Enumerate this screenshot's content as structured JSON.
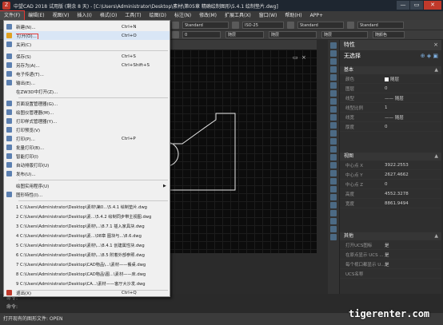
{
  "titlebar": {
    "title": "中望CAD 2018 试用版 (剩余 8 天) - [C:\\Users\\Administrator\\Desktop\\素材\\第05章 精确绘制图形\\5.4.1 绘制垫片.dwg]",
    "minimize": "—",
    "maximize": "▭",
    "close": "✕"
  },
  "menubar": [
    "文件(F)",
    "编辑(E)",
    "视图(V)",
    "插入(I)",
    "格式(O)",
    "工具(T)",
    "绘图(D)",
    "标注(N)",
    "修改(M)",
    "扩展工具(X)",
    "窗口(W)",
    "帮助(H)",
    "APP+"
  ],
  "toolbar": {
    "text_style": "Standard",
    "dim_style": "ISO-25",
    "table_style": "Standard",
    "multileader_style": "Standard",
    "layer_value": "0",
    "color_value": "随层",
    "linetype_value": "随层",
    "lineweight_value": "随层",
    "plotstyle_value": "随颜色"
  },
  "file_menu": {
    "items": [
      {
        "label": "新建(N)...",
        "shortcut": "Ctrl+N",
        "icon": "new-file-icon"
      },
      {
        "label": "打开(O)...",
        "shortcut": "Ctrl+O",
        "icon": "open-folder-icon",
        "highlighted": true
      },
      {
        "label": "关闭(C)",
        "shortcut": "",
        "icon": "close-file-icon"
      },
      {
        "label": "保存(S)",
        "shortcut": "Ctrl+S",
        "icon": "save-icon"
      },
      {
        "label": "另存为(A)...",
        "shortcut": "Ctrl+Shift+S",
        "icon": "save-as-icon"
      },
      {
        "label": "电子传递(T)...",
        "shortcut": "",
        "icon": "etransmit-icon"
      },
      {
        "label": "输出(E)...",
        "shortcut": "",
        "icon": "export-icon"
      },
      {
        "label": "在ZW3D中打开(Z)...",
        "shortcut": "",
        "icon": "zw3d-icon"
      },
      {
        "label": "页面设置管理器(G)...",
        "shortcut": "",
        "icon": "page-setup-icon"
      },
      {
        "label": "绘图仪管理器(M)...",
        "shortcut": "",
        "icon": "plotter-manager-icon"
      },
      {
        "label": "打印样式管理器(Y)...",
        "shortcut": "",
        "icon": "plot-style-icon"
      },
      {
        "label": "打印预览(V)",
        "shortcut": "",
        "icon": "print-preview-icon"
      },
      {
        "label": "打印(P)...",
        "shortcut": "Ctrl+P",
        "icon": "print-icon"
      },
      {
        "label": "批量打印(B)...",
        "shortcut": "",
        "icon": "batch-print-icon"
      },
      {
        "label": "智能打印(I)",
        "shortcut": "",
        "icon": "smart-print-icon"
      },
      {
        "label": "自动排版打印(U)",
        "shortcut": "",
        "icon": "auto-layout-print-icon"
      },
      {
        "label": "发布(U)...",
        "shortcut": "",
        "icon": "publish-icon"
      },
      {
        "label": "绘图实用程序(U)",
        "shortcut": "",
        "icon": "",
        "submenu": true
      },
      {
        "label": "图形特性(I)...",
        "shortcut": "",
        "icon": "drawing-properties-icon"
      }
    ],
    "recent": [
      "1 C:\\Users\\Administrator\\Desktop\\素材\\第0...\\5.4.1 绘制垫片.dwg",
      "2 C:\\Users\\Administrator\\Desktop\\素...\\5.4.2 绘制同步带主视图.dwg",
      "3 C:\\Users\\Administrator\\Desktop\\素材\\...\\8.7.1 插入家具块.dwg",
      "4 C:\\Users\\Administrator\\Desktop\\素...\\08章 图块与...\\8.6.dwg",
      "5 C:\\Users\\Administrator\\Desktop\\素材\\...\\8.4.1 创建属性块.dwg",
      "6 C:\\Users\\Administrator\\Desktop\\素材\\...\\8.5 附着外部参照.dwg",
      "7 C:\\Users\\Administrator\\Desktop\\CAD物品\\...\\素材——餐桌.dwg",
      "8 C:\\Users\\Administrator\\Desktop\\CAD物品\\图...\\素材——床.dwg",
      "9 C:\\Users\\Administrator\\Desktop\\CA...\\素材——客厅大沙发.dwg"
    ],
    "exit": {
      "label": "退出(X)",
      "shortcut": "Ctrl+Q",
      "icon": "exit-icon"
    }
  },
  "properties_panel": {
    "title": "特性",
    "selection": "无选择",
    "sections": {
      "general": "基本",
      "view": "视图",
      "misc": "其他"
    },
    "general_rows": [
      {
        "key": "颜色",
        "value": "随层"
      },
      {
        "key": "图层",
        "value": "0"
      },
      {
        "key": "线型",
        "value": "—— 随层"
      },
      {
        "key": "线型比例",
        "value": "1"
      },
      {
        "key": "线宽",
        "value": "—— 随层"
      },
      {
        "key": "厚度",
        "value": "0"
      }
    ],
    "view_rows": [
      {
        "key": "中心点 X",
        "value": "3922.2553"
      },
      {
        "key": "中心点 Y",
        "value": "2627.4662"
      },
      {
        "key": "中心点 Z",
        "value": "0"
      },
      {
        "key": "高度",
        "value": "4552.3278"
      },
      {
        "key": "宽度",
        "value": "8861.9494"
      }
    ],
    "misc_rows": [
      {
        "key": "打开UCS图标",
        "value": "是"
      },
      {
        "key": "在原点显示 UCS ...",
        "value": "是"
      },
      {
        "key": "每个视口都显示 U...",
        "value": "是"
      },
      {
        "key": "UCS名称",
        "value": ""
      }
    ]
  },
  "command": {
    "line1": "命令:",
    "line2": "命令:"
  },
  "status": "打开现有的图形文件: OPEN",
  "watermark": "tigerenter.com",
  "colors": {
    "menu_highlight_box": "#e53935",
    "menu_bg": "#f0f0f0",
    "canvas_bg": "#0c0c0c"
  }
}
